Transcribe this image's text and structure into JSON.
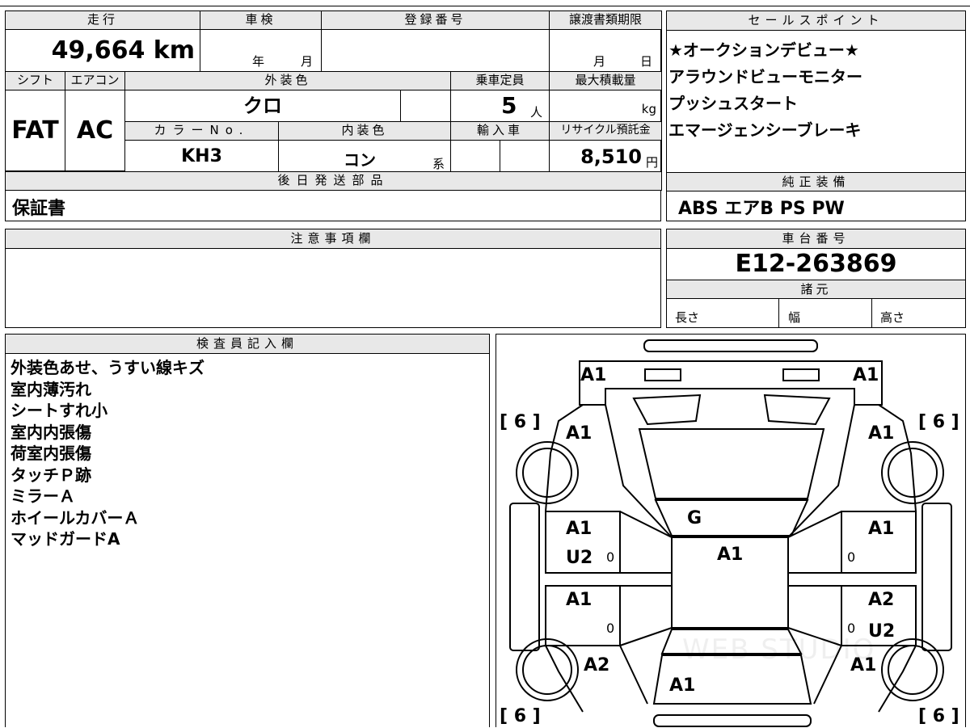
{
  "vehicle": {
    "mileage_label": "走行",
    "mileage": "49,664 km",
    "shaken_label": "車検",
    "shaken_year": "年",
    "shaken_month": "月",
    "reg_label": "登録番号",
    "reg_value": "",
    "transfer_label": "譲渡書類期限",
    "transfer_month": "月",
    "transfer_day": "日",
    "shift_label": "シフト",
    "shift": "FAT",
    "ac_label": "エアコン",
    "ac": "AC",
    "ext_color_label": "外装色",
    "ext_color": "クロ",
    "capacity_label": "乗車定員",
    "capacity": "5",
    "capacity_unit": "人",
    "maxload_label": "最大積載量",
    "maxload_unit": "kg",
    "color_no_label": "カラーNo.",
    "color_no": "KH3",
    "int_color_label": "内装色",
    "int_color": "コン",
    "int_suffix": "系",
    "import_label": "輸入車",
    "recycle_label": "リサイクル預託金",
    "recycle": "8,510",
    "recycle_unit": "円",
    "later_parts_label": "後日発送部品",
    "later_parts": "保証書"
  },
  "sales_points": {
    "label": "セールスポイント",
    "items": [
      "★オークションデビュー★",
      "アラウンドビューモニター",
      "プッシュスタート",
      "エマージェンシーブレーキ"
    ]
  },
  "equipment": {
    "label": "純正装備",
    "value": "ABS エアB PS PW"
  },
  "notes": {
    "label": "注意事項欄",
    "value": ""
  },
  "chassis": {
    "label": "車台番号",
    "value": "E12-263869",
    "spec_label": "諸元",
    "length": "長さ",
    "width": "幅",
    "height": "高さ"
  },
  "inspector": {
    "label": "検査員記入欄",
    "lines": [
      "外装色あせ、うすい線キズ",
      "室内薄汚れ",
      "シートすれ小",
      "室内内張傷",
      "荷室内張傷",
      "タッチＰ跡",
      "ミラーＡ",
      "ホイールカバーＡ",
      "マッドガードA"
    ]
  },
  "diagram": {
    "marks": {
      "front_left": "A1",
      "front_right": "A1",
      "fender_left": "A1",
      "fender_right": "A1",
      "windshield": "G",
      "roof": "A1",
      "door_fl_1": "A1",
      "door_fl_2": "U2",
      "door_fr": "A1",
      "door_rl": "A1",
      "door_rr_1": "A2",
      "door_rr_2": "U2",
      "rear_left": "A2",
      "rear_right": "A1",
      "rear_center": "A1"
    },
    "tires": {
      "fl": "[ 6 ]",
      "fr": "[ 6 ]",
      "rl": "[ 6 ]",
      "rr": "[ 6 ]"
    },
    "door_nums": [
      "0",
      "0",
      "0",
      "0"
    ],
    "watermark": "WEB STUDIO"
  }
}
